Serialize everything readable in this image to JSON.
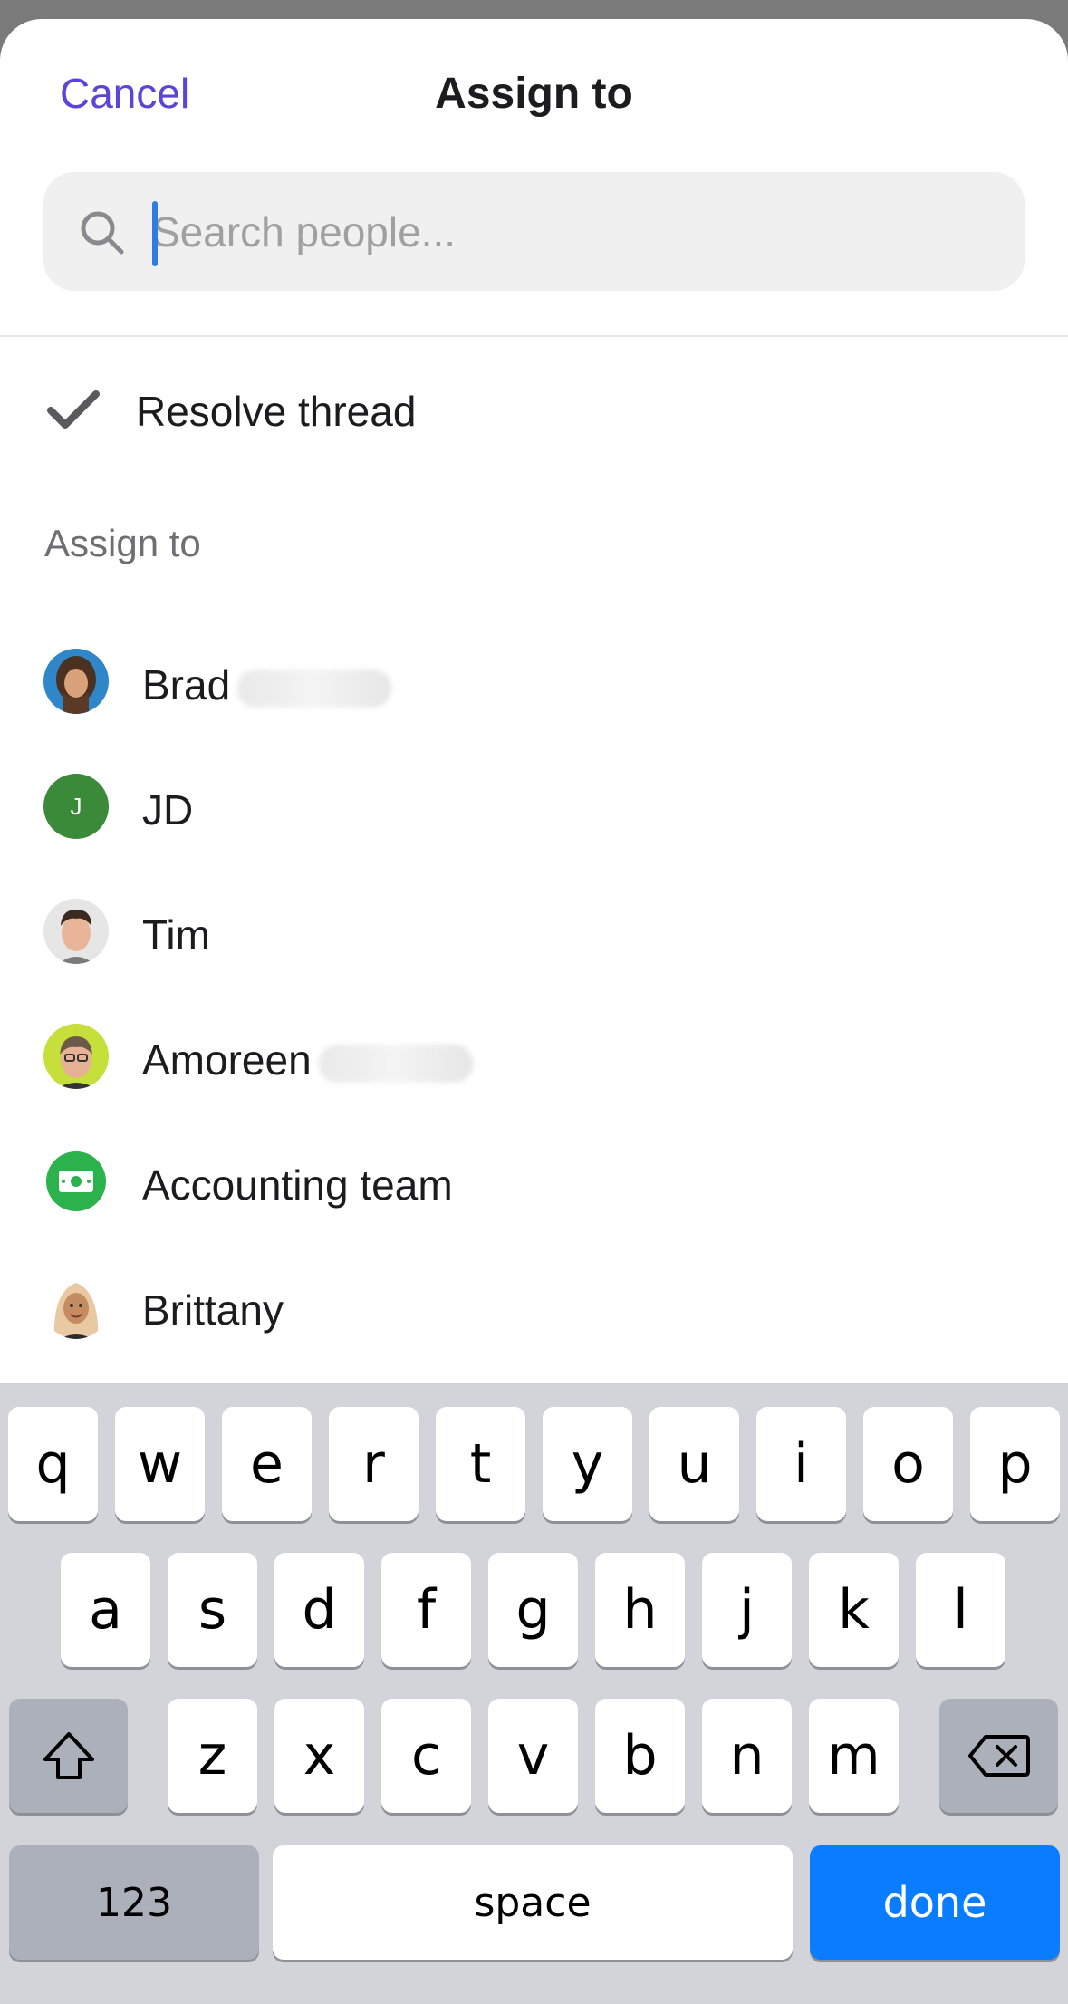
{
  "header": {
    "cancel_label": "Cancel",
    "title": "Assign to"
  },
  "search": {
    "placeholder": "Search people...",
    "value": ""
  },
  "resolve": {
    "label": "Resolve thread",
    "icon": "checkmark-icon"
  },
  "section_label": "Assign to",
  "people": [
    {
      "name": "Brad",
      "surname_blurred": true,
      "avatar": "photo-avatar"
    },
    {
      "name": "JD",
      "initial": "J",
      "avatar": "initial-avatar",
      "color": "#3a8a3a"
    },
    {
      "name": "Tim",
      "avatar": "photo-avatar"
    },
    {
      "name": "Amoreen",
      "surname_blurred": true,
      "avatar": "photo-avatar"
    },
    {
      "name": "Accounting team",
      "avatar": "money-icon",
      "color": "#2bb24c"
    },
    {
      "name": "Brittany",
      "avatar": "memoji-avatar"
    }
  ],
  "keyboard": {
    "row1": [
      "q",
      "w",
      "e",
      "r",
      "t",
      "y",
      "u",
      "i",
      "o",
      "p"
    ],
    "row2": [
      "a",
      "s",
      "d",
      "f",
      "g",
      "h",
      "j",
      "k",
      "l"
    ],
    "row3": [
      "z",
      "x",
      "c",
      "v",
      "b",
      "n",
      "m"
    ],
    "shift_icon": "shift-icon",
    "backspace_icon": "backspace-icon",
    "numbers_label": "123",
    "space_label": "space",
    "done_label": "done"
  },
  "colors": {
    "accent": "#5b45d6",
    "done_key": "#0a7cff",
    "caret": "#2f7de1"
  }
}
